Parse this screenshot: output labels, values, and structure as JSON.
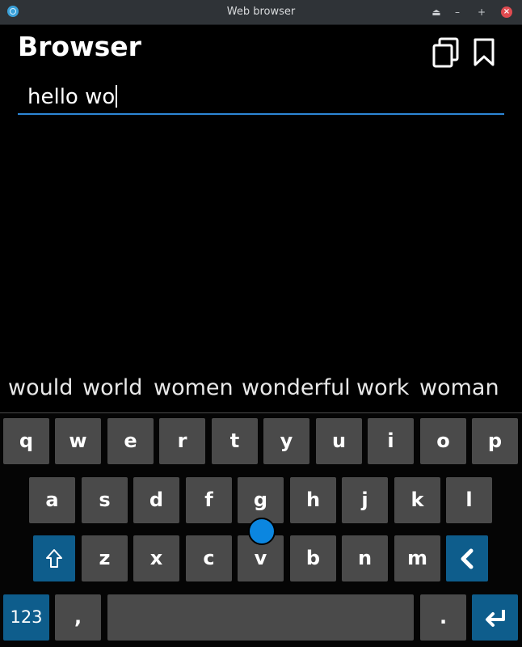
{
  "window": {
    "title": "Web browser"
  },
  "app": {
    "title": "Browser"
  },
  "url_input": {
    "value": "hello wo"
  },
  "suggestions": [
    "would",
    "world",
    "women",
    "wonderful",
    "work",
    "woman"
  ],
  "keyboard": {
    "row1": [
      "q",
      "w",
      "e",
      "r",
      "t",
      "y",
      "u",
      "i",
      "o",
      "p"
    ],
    "row2": [
      "a",
      "s",
      "d",
      "f",
      "g",
      "h",
      "j",
      "k",
      "l"
    ],
    "row3": [
      "z",
      "x",
      "c",
      "v",
      "b",
      "n",
      "m"
    ],
    "numbers_label": "123",
    "comma_label": ",",
    "period_label": "."
  },
  "colors": {
    "accent": "#2d86d6",
    "key": "#4a4a4a",
    "special_key": "#0e5d8c",
    "touch": "#0b86e0"
  },
  "icons": [
    "globe-icon",
    "tabs-icon",
    "bookmark-icon",
    "shift-icon",
    "backspace-icon",
    "enter-icon"
  ]
}
